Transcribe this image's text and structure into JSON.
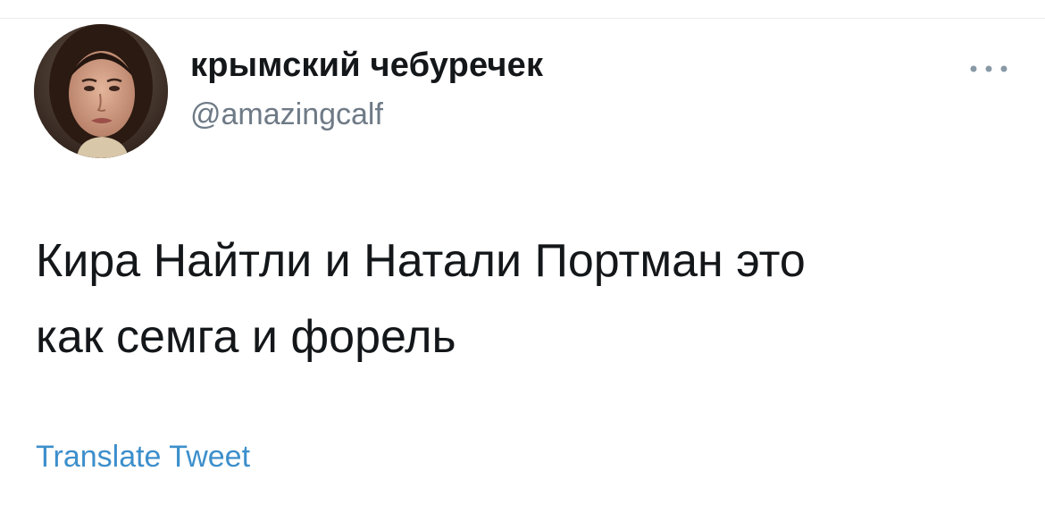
{
  "tweet": {
    "author": {
      "display_name": "крымский чебуречек",
      "handle": "@amazingcalf",
      "avatar_icon": "profile-photo"
    },
    "text": "Кира Найтли и Натали Портман это\nкак семга и форель",
    "translate_label": "Translate Tweet",
    "more_icon": "more-dots-icon"
  },
  "colors": {
    "text": "#14171a",
    "handle": "#6e7a86",
    "link": "#3d8fcb",
    "divider": "#e9ecee",
    "background": "#ffffff"
  }
}
